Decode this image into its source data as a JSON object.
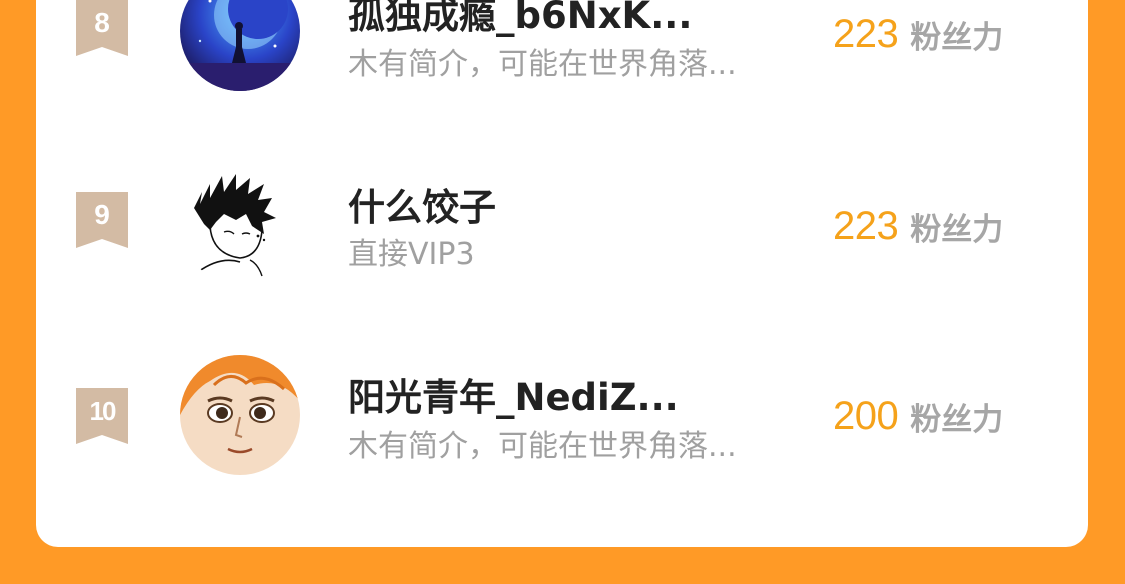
{
  "ranking": {
    "unit_label": "粉丝力",
    "items": [
      {
        "rank": "8",
        "name": "孤独成瘾_b6NxK...",
        "intro": "木有简介，可能在世界角落...",
        "fans": "223",
        "avatar": "night-moon-illustration"
      },
      {
        "rank": "9",
        "name": "什么饺子",
        "intro": "直接VIP3",
        "fans": "223",
        "avatar": "sketch-boy-illustration"
      },
      {
        "rank": "10",
        "name": "阳光青年_NediZ...",
        "intro": "木有简介，可能在世界角落...",
        "fans": "200",
        "avatar": "cartoon-face-illustration"
      }
    ]
  },
  "colors": {
    "page_background": "#FF9A26",
    "card_background": "#FFFFFF",
    "rank_badge": "#D3BBA4",
    "fans_count": "#F5A21B",
    "name_text": "#222222",
    "intro_text": "#A0A0A0"
  }
}
